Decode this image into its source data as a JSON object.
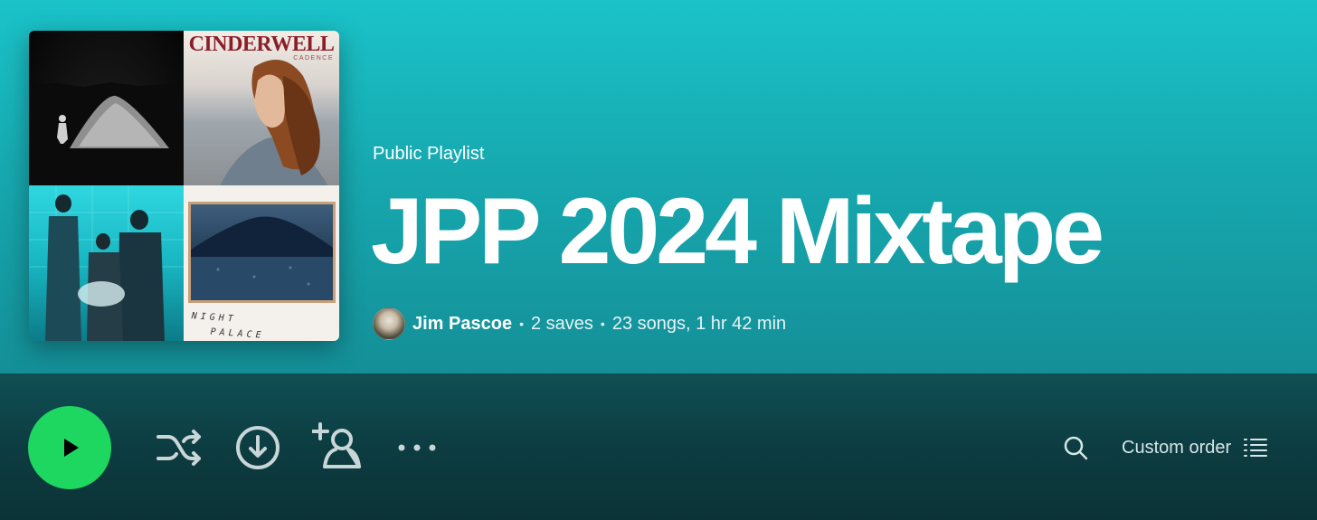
{
  "cover": {
    "tile2_title": "CINDERWELL",
    "tile2_subtitle": "CADENCE",
    "tile4_line1": "NIGHT",
    "tile4_line2": "PALACE"
  },
  "header": {
    "type_label": "Public Playlist",
    "title": "JPP 2024 Mixtape"
  },
  "meta": {
    "owner": "Jim Pascoe",
    "separator": "•",
    "saves": "2 saves",
    "songs_duration": "23 songs, 1 hr 42 min"
  },
  "actions": {
    "play_icon": "play-icon",
    "shuffle_icon": "shuffle-icon",
    "download_icon": "download-icon",
    "add_user_icon": "add-user-icon",
    "more_icon": "more-icon",
    "search_icon": "search-icon",
    "sort_label": "Custom order",
    "sort_icon": "list-icon"
  },
  "colors": {
    "hero_top": "#1ac3c9",
    "hero_bottom": "#148f97",
    "actionbar": "#0c3b40",
    "play_green": "#1ed760"
  }
}
